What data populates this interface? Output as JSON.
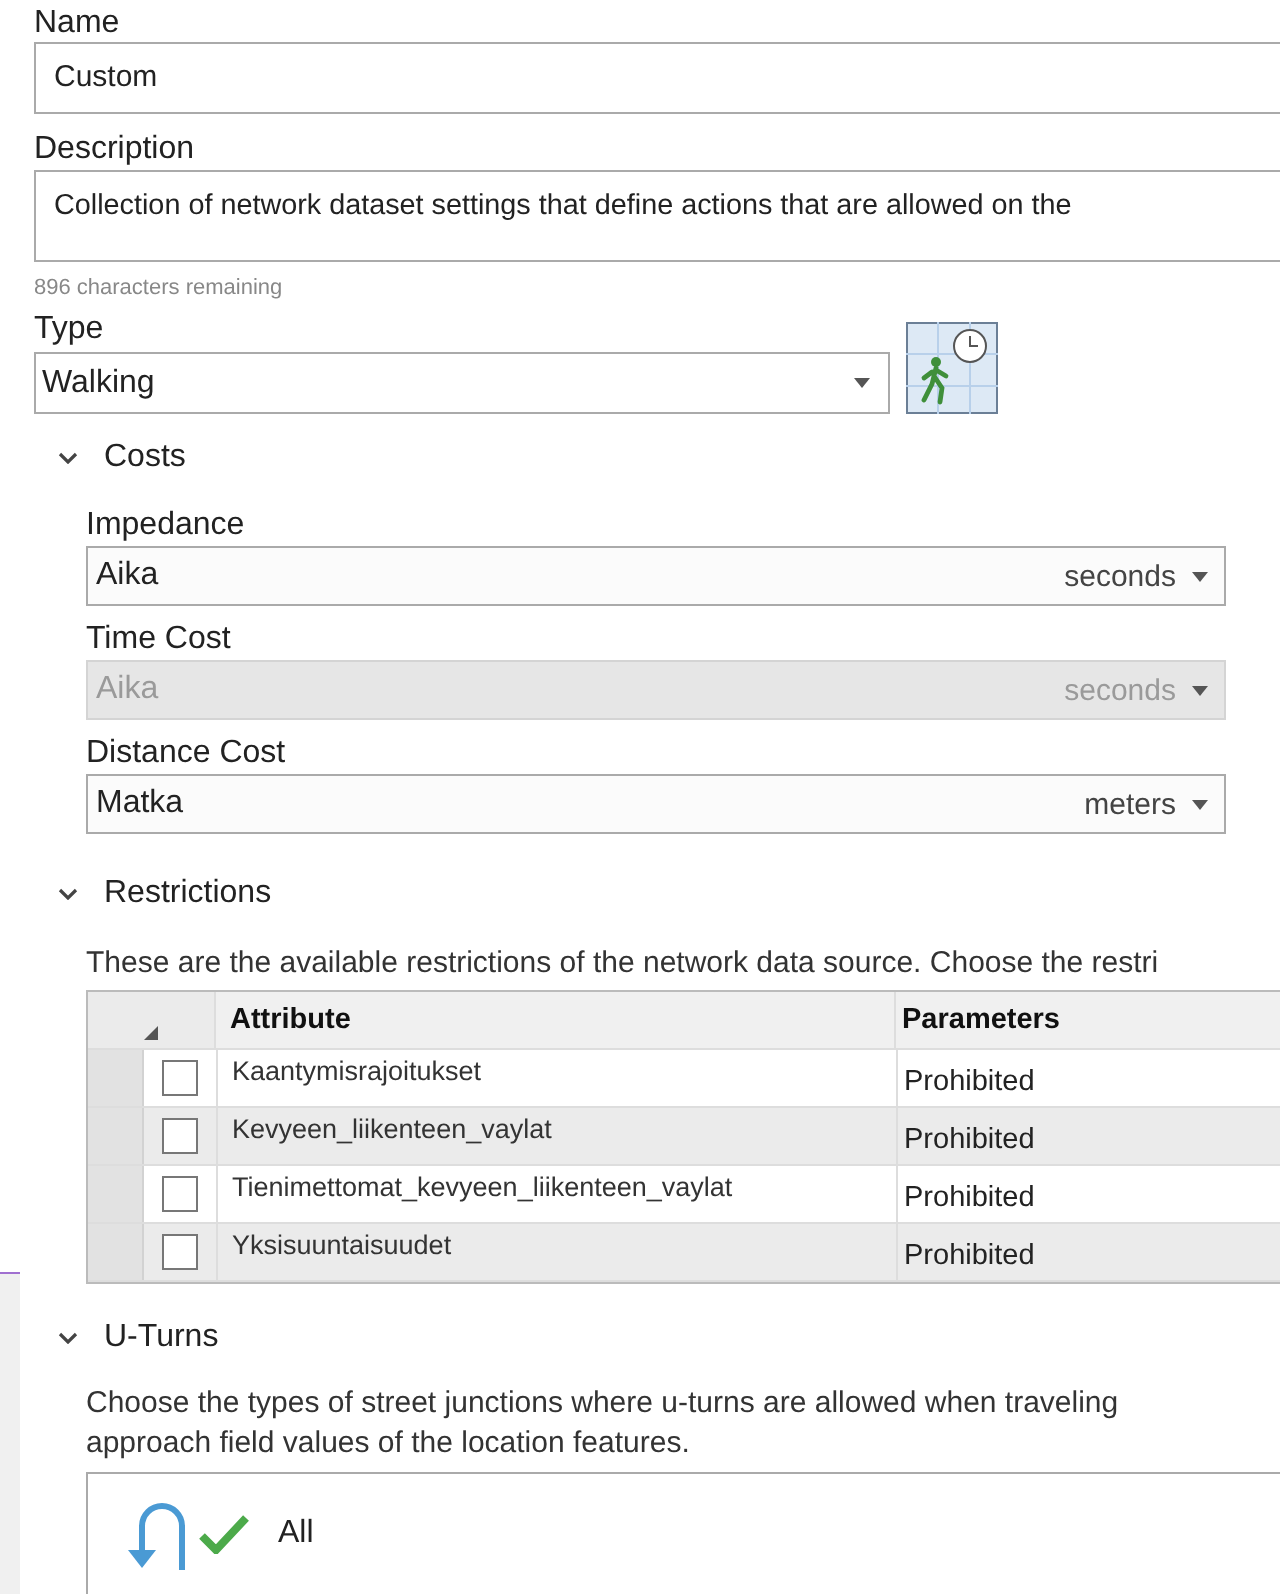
{
  "name": {
    "label": "Name",
    "value": "Custom"
  },
  "description": {
    "label": "Description",
    "value": "Collection of network dataset settings that define actions that are allowed on the",
    "remaining": "896 characters remaining"
  },
  "type": {
    "label": "Type",
    "value": "Walking"
  },
  "costs": {
    "title": "Costs",
    "expanded": true,
    "fields": [
      {
        "label": "Impedance",
        "value": "Aika",
        "unit": "seconds",
        "disabled": false
      },
      {
        "label": "Time Cost",
        "value": "Aika",
        "unit": "seconds",
        "disabled": true
      },
      {
        "label": "Distance Cost",
        "value": "Matka",
        "unit": "meters",
        "disabled": false
      }
    ]
  },
  "restrictions": {
    "title": "Restrictions",
    "expanded": true,
    "description": "These are the available restrictions of the network data source. Choose the restri",
    "columns": [
      "Attribute",
      "Parameters"
    ],
    "rows": [
      {
        "attribute": "Kaantymisrajoitukset",
        "parameter": "Prohibited",
        "checked": false
      },
      {
        "attribute": "Kevyeen_liikenteen_vaylat",
        "parameter": "Prohibited",
        "checked": false
      },
      {
        "attribute": "Tienimettomat_kevyeen_liikenteen_vaylat",
        "parameter": "Prohibited",
        "checked": false
      },
      {
        "attribute": "Yksisuuntaisuudet",
        "parameter": "Prohibited",
        "checked": false
      }
    ]
  },
  "u_turns": {
    "title": "U-Turns",
    "expanded": true,
    "description": [
      "Choose the types of street junctions where u-turns are allowed when traveling",
      "approach field values of the location features."
    ],
    "value": "All"
  }
}
